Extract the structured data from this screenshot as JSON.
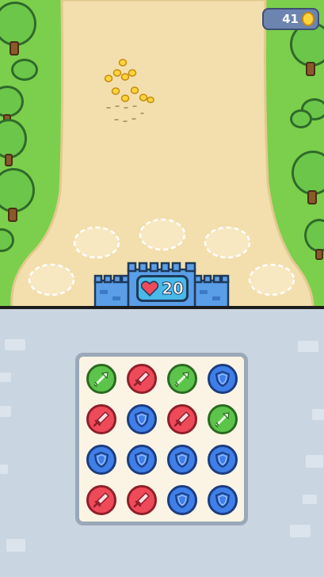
{
  "hud": {
    "coins": "41",
    "coin_icon": "coin-icon",
    "castle_health": "20",
    "health_icon": "heart-icon"
  },
  "colors": {
    "grass": "#7ccf4c",
    "sand": "#f3dfad",
    "red_unit": "#ef4a5a",
    "green_unit": "#5cc44a",
    "blue_unit": "#3f7fe8",
    "board_bg": "#fbf4e4",
    "panel_bg": "#c9d5e0"
  },
  "board": {
    "rows": 4,
    "cols": 4,
    "tiles": [
      [
        "green-arrow",
        "red-sword",
        "green-arrow",
        "blue-shield"
      ],
      [
        "red-sword",
        "blue-shield",
        "red-sword",
        "green-arrow"
      ],
      [
        "blue-shield",
        "blue-shield",
        "blue-shield",
        "blue-shield"
      ],
      [
        "red-sword",
        "red-sword",
        "blue-shield",
        "blue-shield"
      ]
    ]
  }
}
